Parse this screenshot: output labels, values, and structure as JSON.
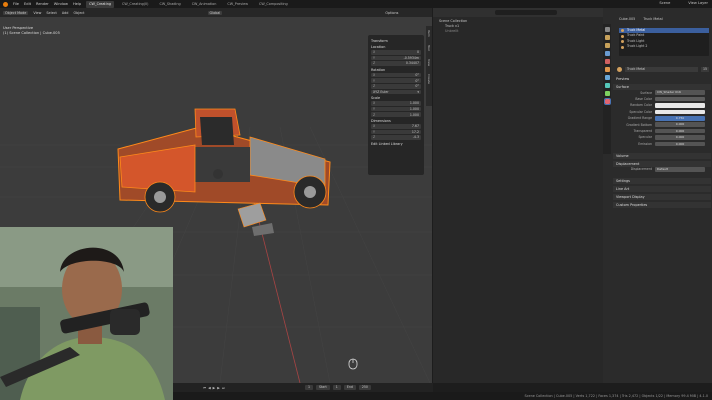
{
  "menu": [
    "File",
    "Edit",
    "Render",
    "Window",
    "Help"
  ],
  "workspaces": [
    {
      "label": "CW_Creating",
      "active": true
    },
    {
      "label": "CW_Creating(II)",
      "active": false
    },
    {
      "label": "CW_Shading",
      "active": false
    },
    {
      "label": "CW_Animation",
      "active": false
    },
    {
      "label": "CW_Preview",
      "active": false
    },
    {
      "label": "CW_Compositing",
      "active": false
    }
  ],
  "topright": {
    "scene": "Scene",
    "view_layer": "View Layer"
  },
  "viewport_header": {
    "mode": "Object Mode",
    "menus": [
      "View",
      "Select",
      "Add",
      "Object"
    ],
    "orientation": "Global",
    "options": "Options"
  },
  "viewport_info": {
    "line1": "User Perspective",
    "line2": "(1) Scene Collection | Cube.005"
  },
  "n_panel": {
    "transform": "Transform",
    "location": "Location",
    "loc": [
      {
        "a": "X",
        "v": "0"
      },
      {
        "a": "Y",
        "v": "-0.5934m"
      },
      {
        "a": "Z",
        "v": "0.34407"
      }
    ],
    "rotation": "Rotation",
    "rot": [
      {
        "a": "X",
        "v": "0°"
      },
      {
        "a": "Y",
        "v": "0°"
      },
      {
        "a": "Z",
        "v": "0°"
      }
    ],
    "rotation_mode": "XYZ Euler",
    "scale": "Scale",
    "scl": [
      {
        "a": "X",
        "v": "1.000"
      },
      {
        "a": "Y",
        "v": "1.000"
      },
      {
        "a": "Z",
        "v": "1.000"
      }
    ],
    "dimensions": "Dimensions",
    "dim": [
      {
        "a": "X",
        "v": "7.67"
      },
      {
        "a": "Y",
        "v": "17.2"
      },
      {
        "a": "Z",
        "v": "-4.3"
      }
    ],
    "edit_linked": "Edit Linked Library"
  },
  "n_tabs": [
    "Item",
    "Tool",
    "View",
    "Create"
  ],
  "outliner": {
    "items": [
      "Scene Collection",
      "Truck v1",
      "Unbrellt"
    ]
  },
  "properties": {
    "object": "Cube.005",
    "material_name": "Truck Metal",
    "slots": [
      "Truck Metal",
      "Truck Paint",
      "Truck Light",
      "Truck Light 2"
    ],
    "selected_slot": 0,
    "slot_count": "15",
    "preview": "Preview",
    "surface_section": "Surface",
    "surface": {
      "label": "Surface",
      "value": "CW_Shader 016"
    },
    "rows": [
      {
        "label": "Base Color",
        "value": "",
        "kind": "grey"
      },
      {
        "label": "Random Color",
        "value": "",
        "kind": "white"
      },
      {
        "label": "Specular Color",
        "value": "",
        "kind": "white"
      },
      {
        "label": "Gradient Range",
        "value": "0.750",
        "kind": "blue"
      },
      {
        "label": "Gradient Bottom",
        "value": "0.000",
        "kind": "normal"
      },
      {
        "label": "Transparent",
        "value": "0.000",
        "kind": "normal"
      },
      {
        "label": "Specular",
        "value": "0.000",
        "kind": "normal"
      },
      {
        "label": "Emission",
        "value": "0.000",
        "kind": "normal"
      }
    ],
    "volume": "Volume",
    "displacement_section": "Displacement",
    "displacement": {
      "label": "Displacement",
      "value": "Default"
    },
    "collapsed": [
      "Settings",
      "Line Art",
      "Viewport Display",
      "Custom Properties"
    ]
  },
  "timeline": {
    "current": "1",
    "start_label": "Start",
    "start": "1",
    "end_label": "End",
    "end": "250"
  },
  "statusbar": "Scene Collection | Cube.005 | Verts 1,722 | Faces 1,374 | Tris 2,472 | Objects 1/22 | Memory 99.4 MiB | 4.1.0",
  "colors": {
    "accent": "#e87d0d",
    "selection": "#ff8a1a",
    "active_blue": "#4772b3"
  }
}
